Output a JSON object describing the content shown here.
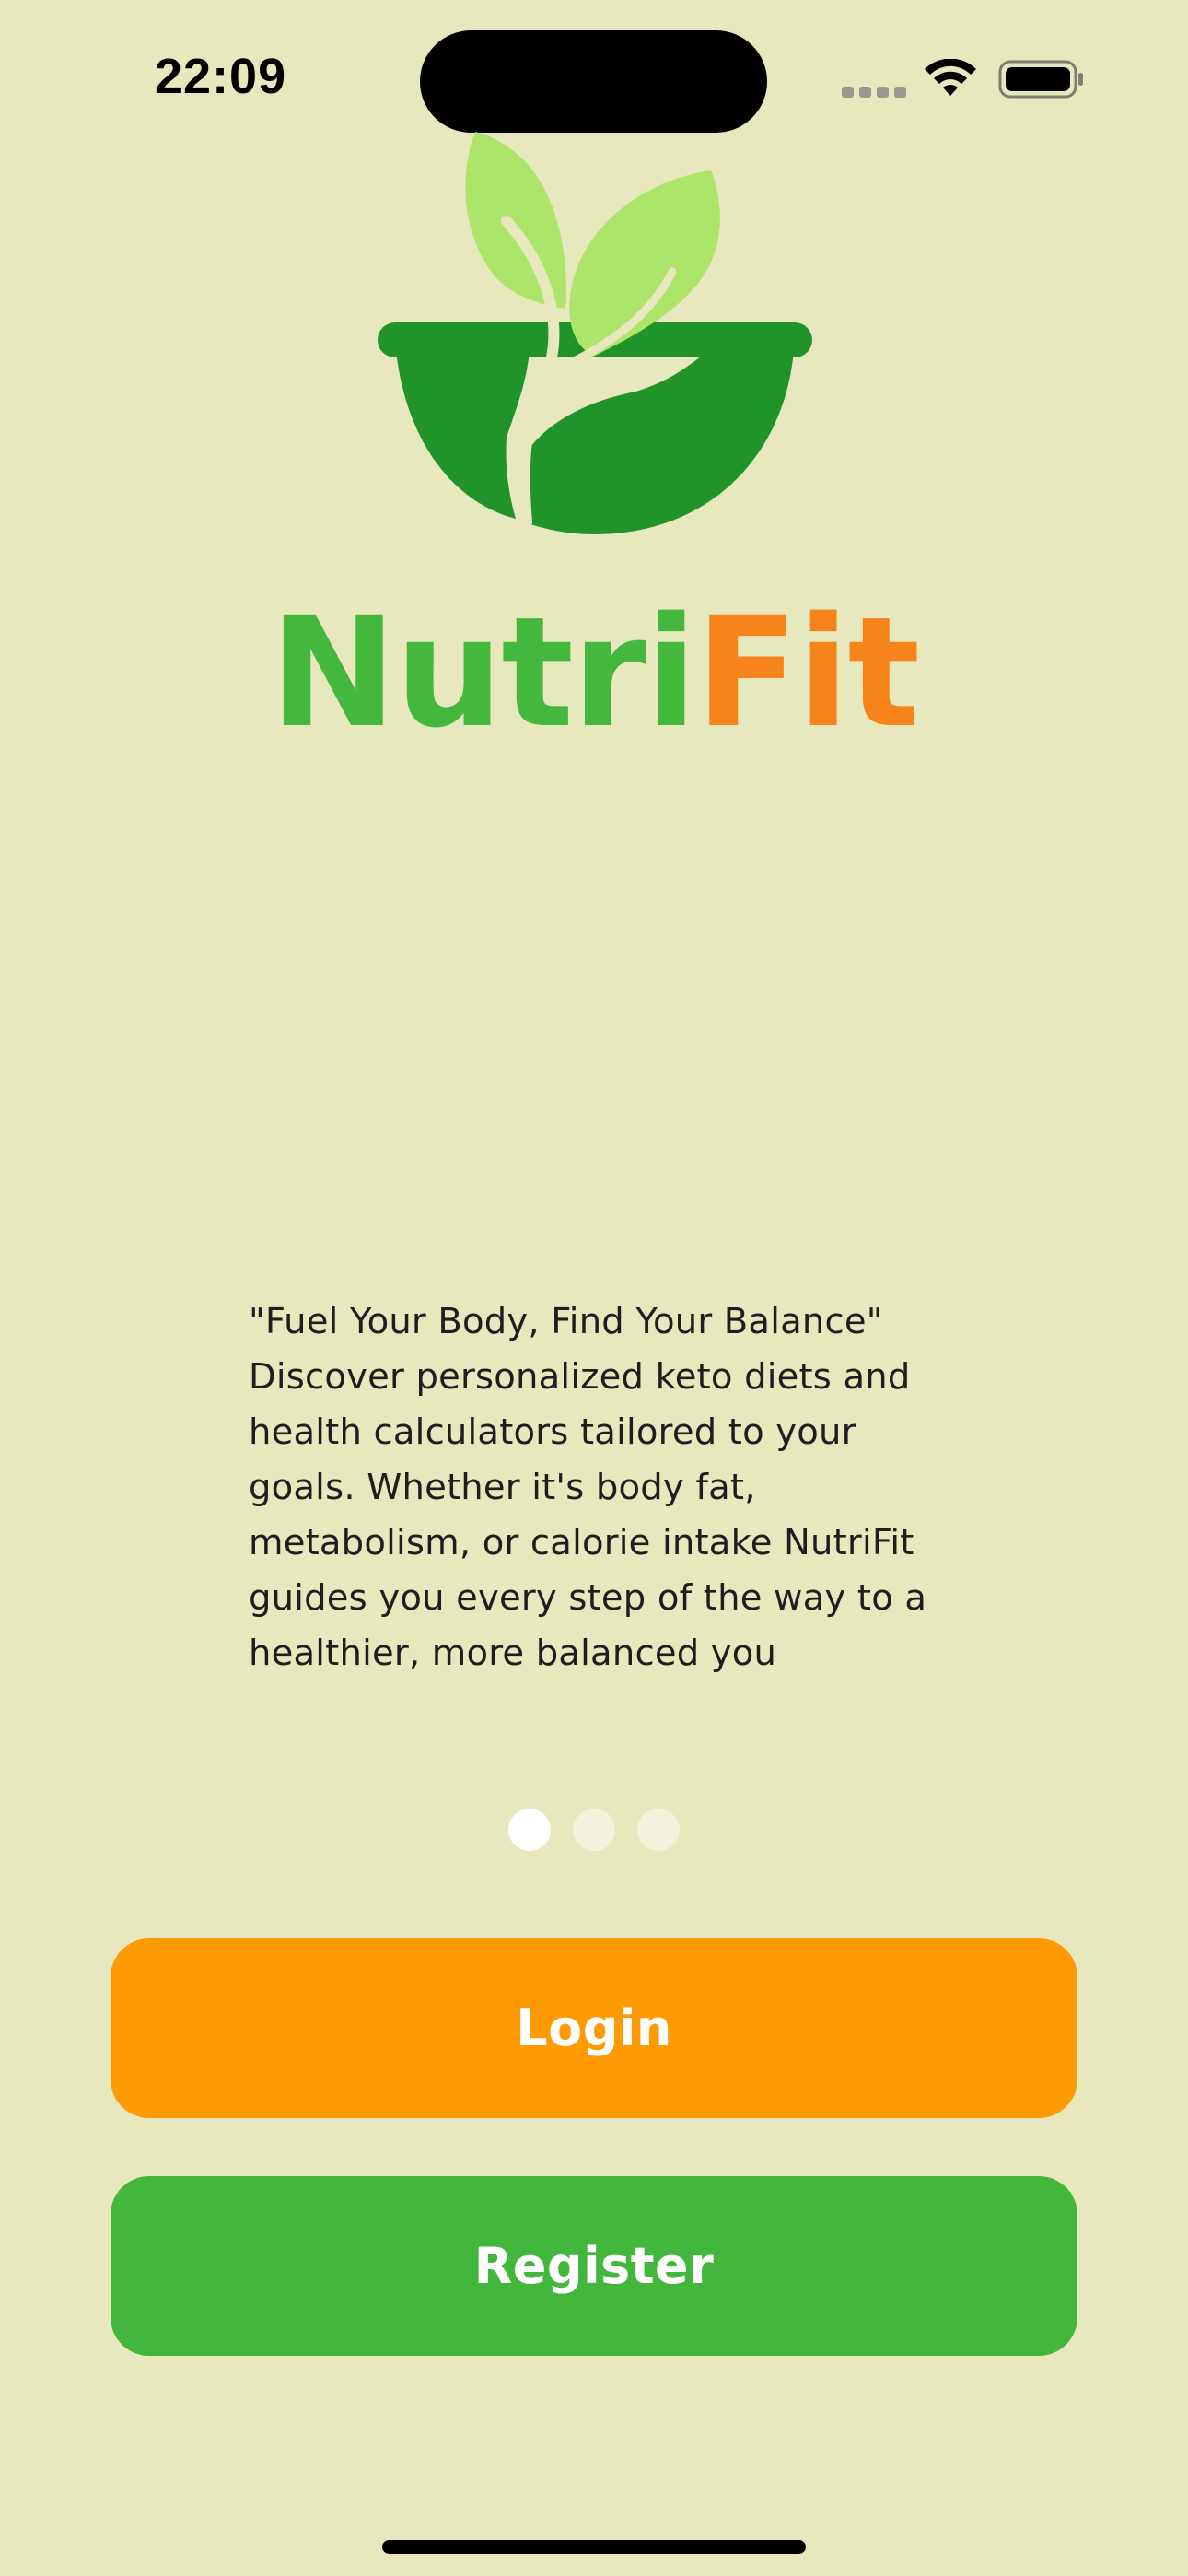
{
  "status_bar": {
    "time": "22:09",
    "icons": [
      "signal-icon",
      "wifi-icon",
      "battery-icon"
    ]
  },
  "brand": {
    "name_part1": "Nutri",
    "name_part2": "Fit",
    "logo_icon": "bowl-with-leaves-icon"
  },
  "intro": {
    "lines": [
      "\"Fuel Your Body, Find Your Balance\"",
      "Discover personalized keto diets and",
      "health calculators tailored to your",
      "goals. Whether it's body fat,",
      "metabolism, or calorie intake NutriFit",
      "guides you every step of the way to a",
      "healthier, more balanced you"
    ]
  },
  "pager": {
    "count": 3,
    "active_index": 0
  },
  "actions": {
    "login_label": "Login",
    "register_label": "Register"
  },
  "colors": {
    "background": "#E7E8BD",
    "green": "#44B83C",
    "orange": "#F7831B",
    "login_button": "#FE9A03",
    "register_button": "#42B73C",
    "leaf_light": "#ADE46A",
    "bowl_dark": "#20932B"
  }
}
